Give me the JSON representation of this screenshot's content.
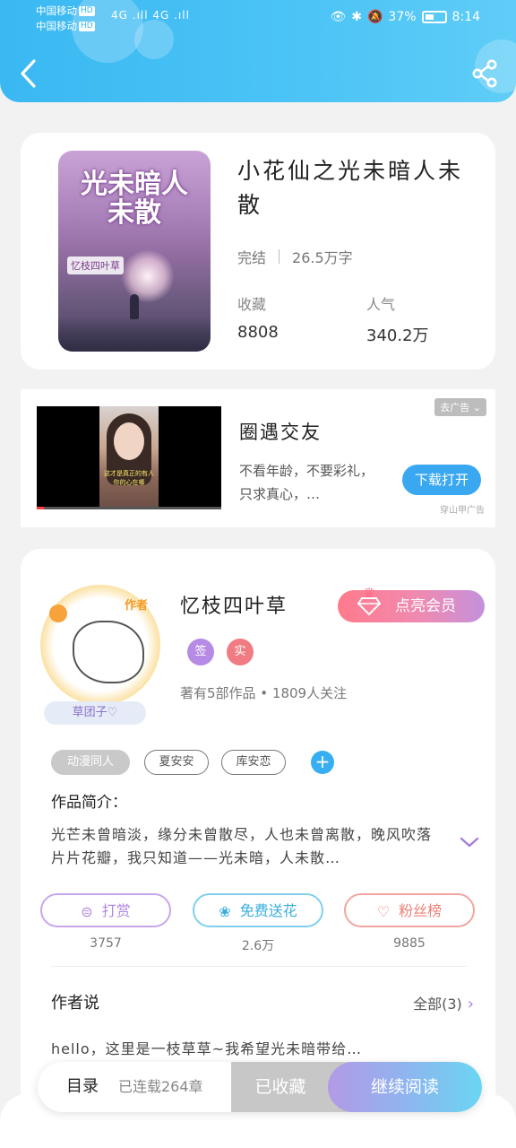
{
  "status_bar": {
    "carrier1": "中国移动",
    "carrier2": "中国移动",
    "hd": "HD",
    "signal": "4G .ıll 4G .ıll",
    "right": "37%",
    "time": "8:14"
  },
  "book": {
    "cover_title": "光未暗人未散",
    "cover_author": "忆枝四叶草",
    "title": "小花仙之光未暗人未散",
    "status": "完结",
    "word_count": "26.5万字",
    "favorites_label": "收藏",
    "favorites_value": "8808",
    "popularity_label": "人气",
    "popularity_value": "340.2万"
  },
  "ad": {
    "close_label": "去广告",
    "caption": "这才是真正的有人你的心在哪",
    "title": "圈遇交友",
    "desc": "不看年龄，不要彩礼，只求真心，…",
    "button": "下载打开",
    "source": "穿山甲广告"
  },
  "author": {
    "avatar_tag": "作者",
    "ribbon": "草团子♡",
    "name": "忆枝四叶草",
    "vip_button": "点亮会员",
    "badge1": "签",
    "badge2": "实",
    "works": "著有5部作品 • 1809人关注",
    "tags": [
      "动漫同人",
      "夏安安",
      "库安恋"
    ],
    "tag_add": "+",
    "intro_label": "作品简介：",
    "intro_text": "光芒未曾暗淡，缘分未曾散尽，人也未曾离散，晚风吹落片片花瓣，我只知道——光未暗，人未散…",
    "actions": {
      "reward": "打赏",
      "flower": "免费送花",
      "fans": "粉丝榜"
    },
    "counts": {
      "reward": "3757",
      "flower": "2.6万",
      "fans": "9885"
    },
    "say_label": "作者说",
    "say_all": "全部(3)",
    "say_text": "hello，这里是一枝草草~我希望光未暗带给…"
  },
  "bottom_bar": {
    "toc": "目录",
    "serial": "已连载264章",
    "collected": "已收藏",
    "read": "继续阅读"
  },
  "colors": {
    "header": "#3ab8f2",
    "accent_blue": "#37aef2",
    "vip_pink": "#ff7a8c",
    "read_gradient_start": "#b39ae6",
    "read_gradient_end": "#6ad6f2"
  }
}
